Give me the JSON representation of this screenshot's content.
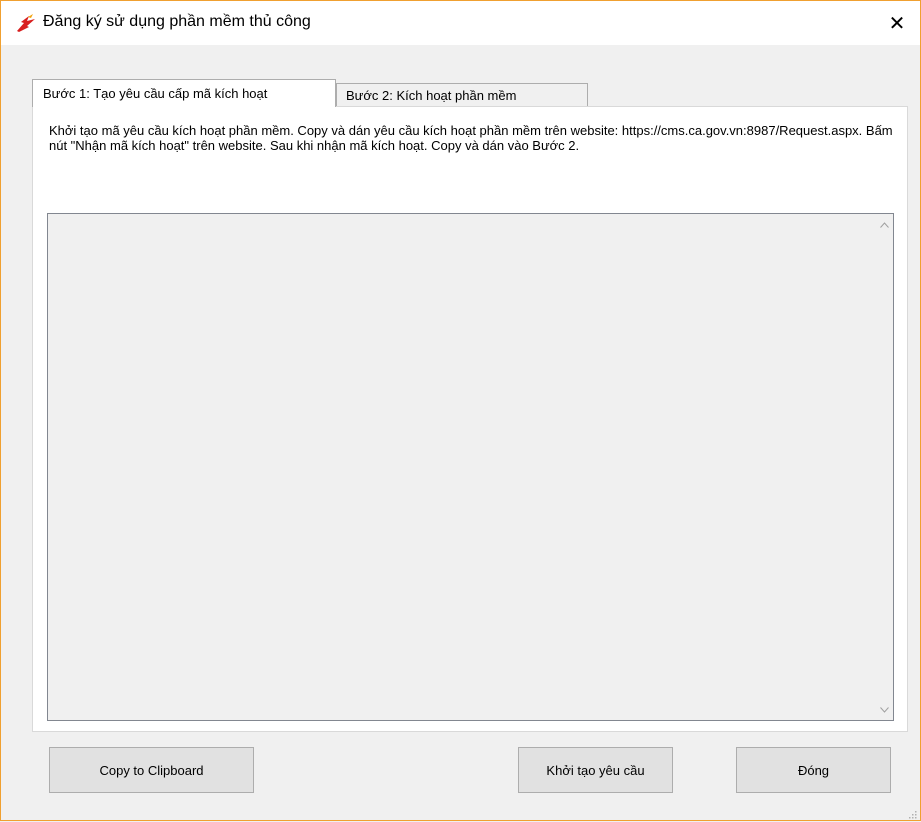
{
  "window": {
    "title": "Đăng ký sử dụng phần mềm thủ công",
    "icon": "app-logo-icon",
    "close_symbol": "✕",
    "accent_border": "#f0a030"
  },
  "tabs": [
    {
      "label": "Bước 1: Tạo yêu cầu cấp mã kích hoạt",
      "active": true
    },
    {
      "label": "Bước 2: Kích hoạt phần mềm",
      "active": false
    }
  ],
  "step1": {
    "instructions": "Khởi tạo mã yêu cầu kích hoạt phần mềm. Copy và dán yêu cầu kích hoạt phần mềm trên website: https://cms.ca.gov.vn:8987/Request.aspx. Bấm nút \"Nhận mã kích hoạt\" trên website. Sau khi nhận mã kích hoạt. Copy và dán vào Bước 2.",
    "request_text": ""
  },
  "buttons": {
    "copy": "Copy to Clipboard",
    "create": "Khởi tạo yêu cầu",
    "close": "Đóng"
  }
}
